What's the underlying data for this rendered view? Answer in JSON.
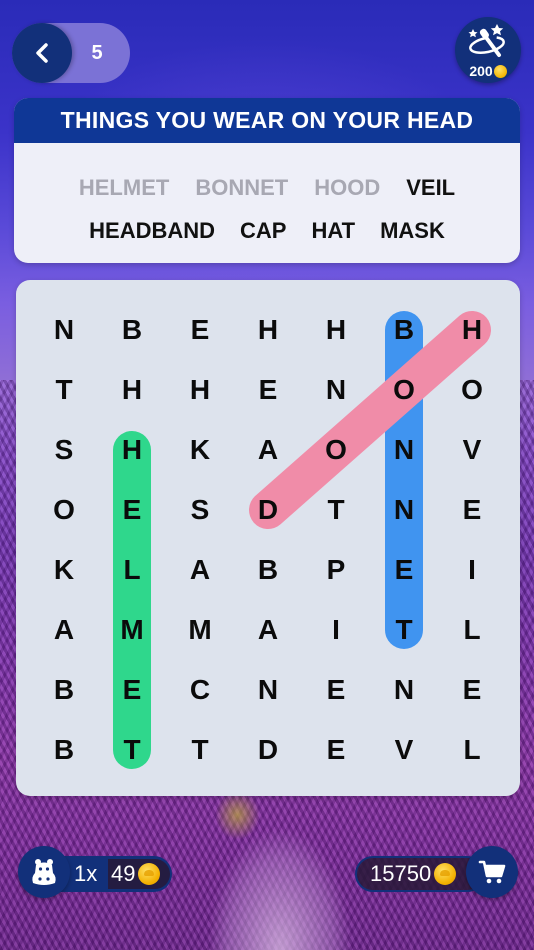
{
  "header": {
    "level": "5",
    "back_icon": "chevron-left-icon",
    "hint": {
      "icon": "magic-wand-icon",
      "cost": "200",
      "currency_icon": "coin-icon"
    }
  },
  "puzzle": {
    "category": "THINGS YOU WEAR ON YOUR HEAD",
    "words": [
      {
        "text": "HELMET",
        "found": true
      },
      {
        "text": "BONNET",
        "found": true
      },
      {
        "text": "HOOD",
        "found": true
      },
      {
        "text": "VEIL",
        "found": false
      },
      {
        "text": "HEADBAND",
        "found": false
      },
      {
        "text": "CAP",
        "found": false
      },
      {
        "text": "HAT",
        "found": false
      },
      {
        "text": "MASK",
        "found": false
      }
    ],
    "grid": [
      [
        "N",
        "B",
        "E",
        "H",
        "H",
        "B",
        "H"
      ],
      [
        "T",
        "H",
        "H",
        "E",
        "N",
        "O",
        "O"
      ],
      [
        "S",
        "H",
        "K",
        "A",
        "O",
        "N",
        "V"
      ],
      [
        "O",
        "E",
        "S",
        "D",
        "T",
        "N",
        "E"
      ],
      [
        "K",
        "L",
        "A",
        "B",
        "P",
        "E",
        "I"
      ],
      [
        "A",
        "M",
        "M",
        "A",
        "I",
        "T",
        "L"
      ],
      [
        "B",
        "E",
        "C",
        "N",
        "E",
        "N",
        "E"
      ],
      [
        "B",
        "T",
        "T",
        "D",
        "E",
        "V",
        "L"
      ]
    ],
    "found_highlights": [
      {
        "word": "HELMET",
        "color": "#2fd78c",
        "from": [
          2,
          1
        ],
        "to": [
          7,
          1
        ]
      },
      {
        "word": "BONNET",
        "color": "#4094f0",
        "from": [
          0,
          5
        ],
        "to": [
          5,
          5
        ]
      },
      {
        "word": "HOOD",
        "color": "#f08ca8",
        "from": [
          0,
          6
        ],
        "to": [
          3,
          3
        ]
      }
    ]
  },
  "footer": {
    "mascot_icon": "hippo-icon",
    "multiplier": "1x",
    "earned_coins": "49",
    "balance": "15750",
    "shop_icon": "shopping-cart-icon"
  }
}
